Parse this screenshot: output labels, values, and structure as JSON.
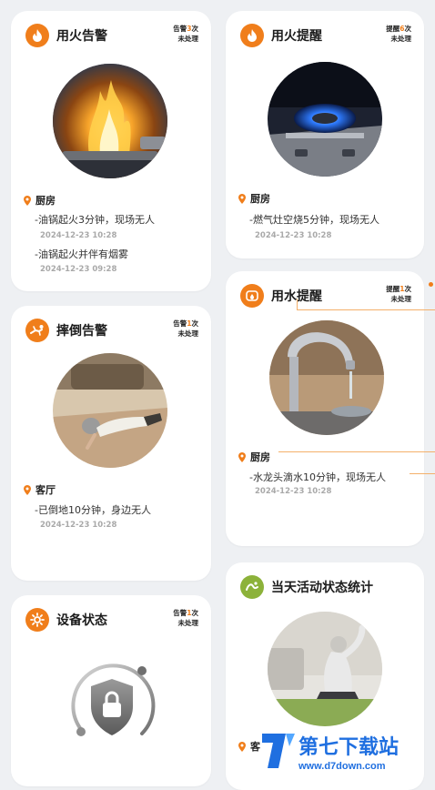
{
  "cards": {
    "fire_alarm": {
      "title": "用火告警",
      "badge_count_prefix": "告警",
      "badge_count": "3",
      "badge_count_suffix": "次",
      "badge_status": "未处理",
      "location": "厨房",
      "events": [
        {
          "text": "-油锅起火3分钟，现场无人",
          "time": "2024-12-23 10:28"
        },
        {
          "text": "-油锅起火并伴有烟雾",
          "time": "2024-12-23 09:28"
        }
      ]
    },
    "fire_reminder": {
      "title": "用火提醒",
      "badge_count_prefix": "提醒",
      "badge_count": "6",
      "badge_count_suffix": "次",
      "badge_status": "未处理",
      "location": "厨房",
      "events": [
        {
          "text": "-燃气灶空烧5分钟，现场无人",
          "time": "2024-12-23 10:28"
        }
      ]
    },
    "fall_alarm": {
      "title": "摔倒告警",
      "badge_count_prefix": "告警",
      "badge_count": "1",
      "badge_count_suffix": "次",
      "badge_status": "未处理",
      "location": "客厅",
      "events": [
        {
          "text": "-已倒地10分钟，身边无人",
          "time": "2024-12-23 10:28"
        }
      ]
    },
    "water_reminder": {
      "title": "用水提醒",
      "badge_count_prefix": "提醒",
      "badge_count": "1",
      "badge_count_suffix": "次",
      "badge_status": "未处理",
      "location": "厨房",
      "events": [
        {
          "text": "-水龙头滴水10分钟，现场无人",
          "time": "2024-12-23 10:28"
        }
      ]
    },
    "device_status": {
      "title": "设备状态",
      "badge_count_prefix": "告警",
      "badge_count": "1",
      "badge_count_suffix": "次",
      "badge_status": "未处理"
    },
    "activity_stats": {
      "title": "当天活动状态统计",
      "location": "客"
    }
  },
  "watermark": {
    "brand": "第七下载站",
    "url": "www.d7down.com"
  },
  "colors": {
    "accent": "#f07e1b",
    "green_icon": "#8cb23a",
    "background": "#eef0f3",
    "card": "#ffffff",
    "time_text": "#a9a9a9"
  },
  "icons": {
    "fire_alarm": "flame-icon",
    "fire_reminder": "flame-icon",
    "fall_alarm": "person-fall-icon",
    "water_reminder": "water-tap-icon",
    "device_status": "gear-icon",
    "activity_stats": "activity-icon",
    "location": "map-pin-icon",
    "device_lock": "lock-shield-icon"
  }
}
